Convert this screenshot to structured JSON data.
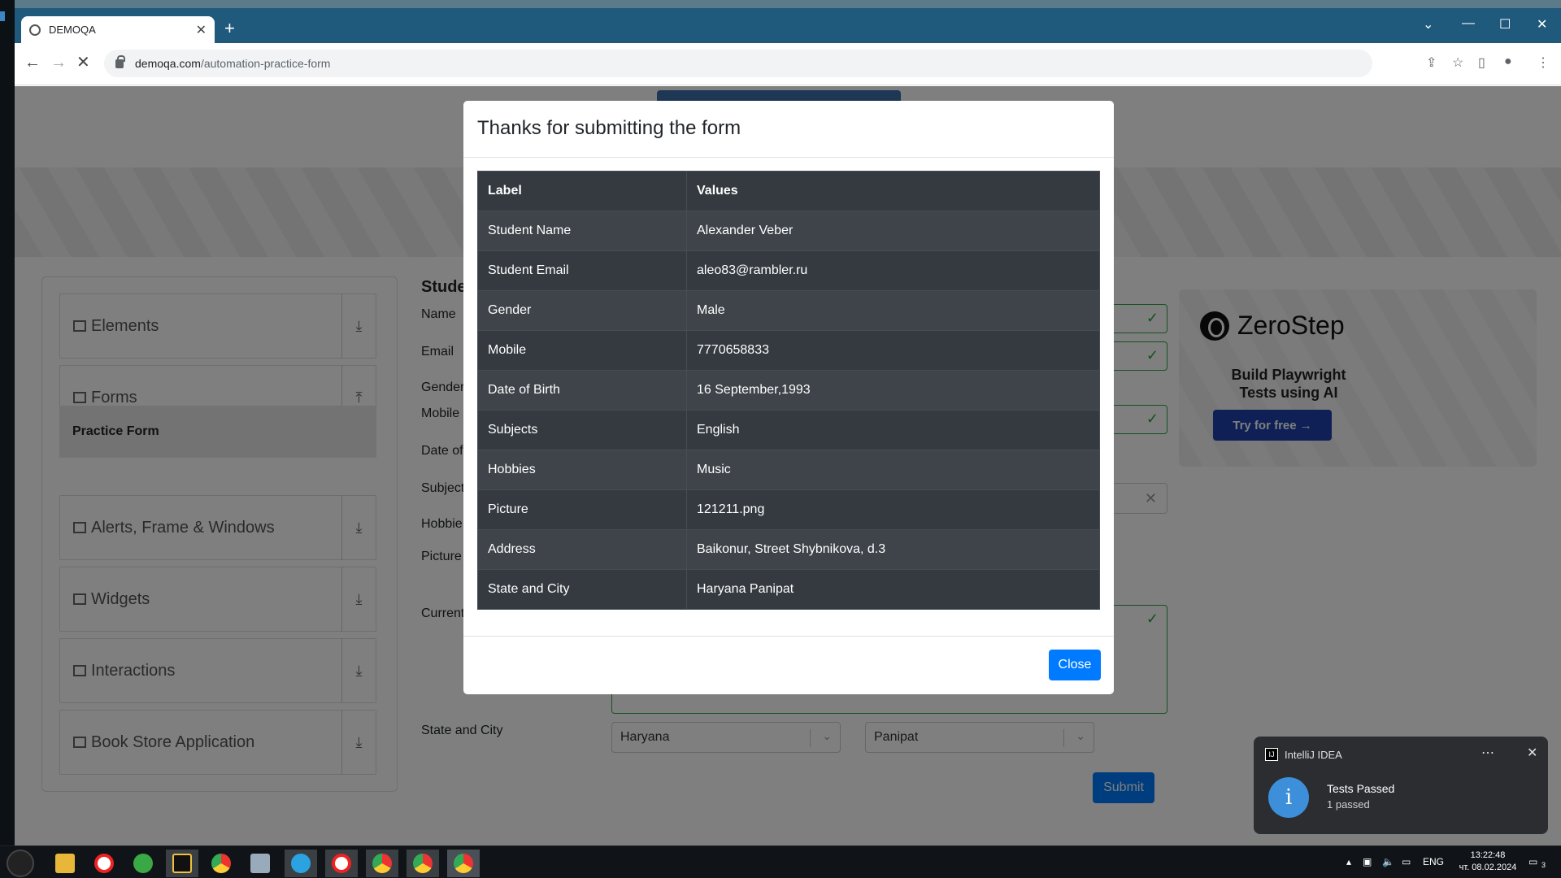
{
  "browser": {
    "tab_title": "DEMOQA",
    "new_tab": "+",
    "url_domain": "demoqa.com",
    "url_path": "/automation-practice-form"
  },
  "sidebar": {
    "groups": [
      {
        "label": "Elements"
      },
      {
        "label": "Forms"
      },
      {
        "label": "Alerts, Frame & Windows"
      },
      {
        "label": "Widgets"
      },
      {
        "label": "Interactions"
      },
      {
        "label": "Book Store Application"
      }
    ],
    "active_item": "Practice Form"
  },
  "form": {
    "title_partial": "Stude",
    "labels": {
      "name": "Name",
      "email": "Email",
      "gender": "Gender",
      "mobile": "Mobile",
      "dob": "Date of",
      "subjects": "Subject",
      "hobbies": "Hobbie",
      "picture": "Picture",
      "current": "Current",
      "state_city": "State and City"
    },
    "state_value": "Haryana",
    "city_value": "Panipat",
    "submit_label": "Submit"
  },
  "ad": {
    "brand": "ZeroStep",
    "tagline_line1": "Build Playwright",
    "tagline_line2": "Tests using AI",
    "cta": "Try for free →"
  },
  "modal": {
    "title": "Thanks for submitting the form",
    "headers": {
      "label": "Label",
      "values": "Values"
    },
    "rows": [
      {
        "label": "Student Name",
        "value": "Alexander Veber"
      },
      {
        "label": "Student Email",
        "value": "aleo83@rambler.ru"
      },
      {
        "label": "Gender",
        "value": "Male"
      },
      {
        "label": "Mobile",
        "value": "7770658833"
      },
      {
        "label": "Date of Birth",
        "value": "16 September,1993"
      },
      {
        "label": "Subjects",
        "value": "English"
      },
      {
        "label": "Hobbies",
        "value": "Music"
      },
      {
        "label": "Picture",
        "value": "121211.png"
      },
      {
        "label": "Address",
        "value": "Baikonur, Street Shybnikova, d.3"
      },
      {
        "label": "State and City",
        "value": "Haryana Panipat"
      }
    ],
    "close_label": "Close"
  },
  "notification": {
    "app": "IntelliJ IDEA",
    "title": "Tests Passed",
    "detail": "1 passed"
  },
  "taskbar": {
    "lang": "ENG",
    "time": "13:22:48",
    "date": "чт. 08.02.2024",
    "badge": "3"
  },
  "colors": {
    "accent": "#007bff",
    "success": "#28a745",
    "tabbar": "#1f5a7c",
    "table_dark": "#343a40"
  }
}
